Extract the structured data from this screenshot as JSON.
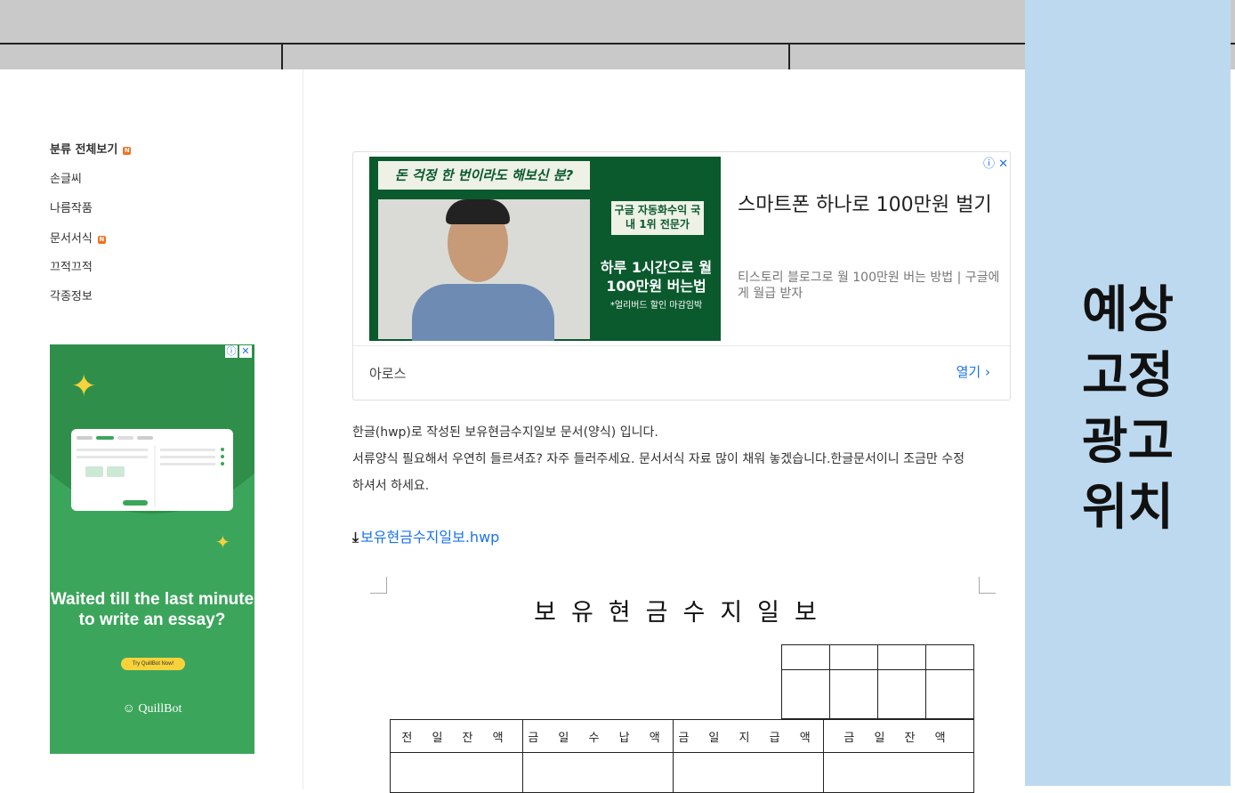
{
  "sidebar": {
    "categories": [
      {
        "label": "분류 전체보기",
        "new_badge": "N"
      },
      {
        "label": "손글씨"
      },
      {
        "label": "나름작품"
      },
      {
        "label": "문서서식",
        "new_badge": "N"
      },
      {
        "label": "끄적끄적"
      },
      {
        "label": "각종정보"
      }
    ],
    "quillbot_ad": {
      "headline": "Waited till the last minute to write an essay?",
      "cta": "Try QuillBot Now!",
      "brand": "QuillBot",
      "adchoices_info": "ⓘ",
      "adchoices_close": "✕"
    }
  },
  "content_ad": {
    "image_banner": "돈 걱정 한 번이라도 해보신 분?",
    "image_label": "구글 자동화수익 국내 1위 전문가",
    "image_headline": "하루 1시간으로 월 100만원 버는법",
    "image_note": "*얼리버드 할인 마감임박",
    "title": "스마트폰 하나로 100만원 벌기",
    "description": "티스토리 블로그로 월 100만원 버는 방법 | 구글에게 월급 받자",
    "advertiser": "아로스",
    "open_label": "열기",
    "adchoices": "ⓘ ✕",
    "accent_color": "#1a73e8"
  },
  "article": {
    "paragraph1": "한글(hwp)로 작성된 보유현금수지일보 문서(양식) 입니다.",
    "paragraph2_line1": "서류양식 필요해서 우연히 들르셔죠? 자주 들러주세요. 문서서식 자료 많이 채워 놓겠습니다.한글문서이니 조금만 수정",
    "paragraph2_line2": "하셔서 하세요.",
    "download_link": "보유현금수지일보.hwp"
  },
  "document_preview": {
    "title": "보유현금수지일보",
    "table_headers": [
      "전 일 잔 액",
      "금 일 수 납 액",
      "금 일 지 급 액",
      "금 일 잔 액"
    ]
  },
  "fixed_ad_placeholder": {
    "lines": [
      "예상",
      "고정",
      "광고",
      "위치"
    ],
    "background": "#bdd9f0"
  }
}
